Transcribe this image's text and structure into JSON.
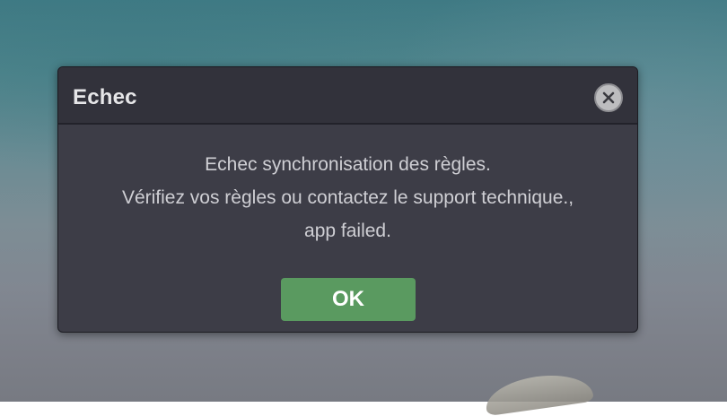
{
  "dialog": {
    "title": "Echec",
    "close_icon": "close-icon",
    "message_lines": [
      "Echec synchronisation des règles.",
      "Vérifiez vos règles ou contactez le support technique.,",
      "app failed."
    ],
    "ok_label": "OK"
  },
  "colors": {
    "dialog_background": "#3d3d47",
    "header_background": "#32323b",
    "ok_button": "#5a9a60",
    "message_text": "#cfcfd4"
  }
}
